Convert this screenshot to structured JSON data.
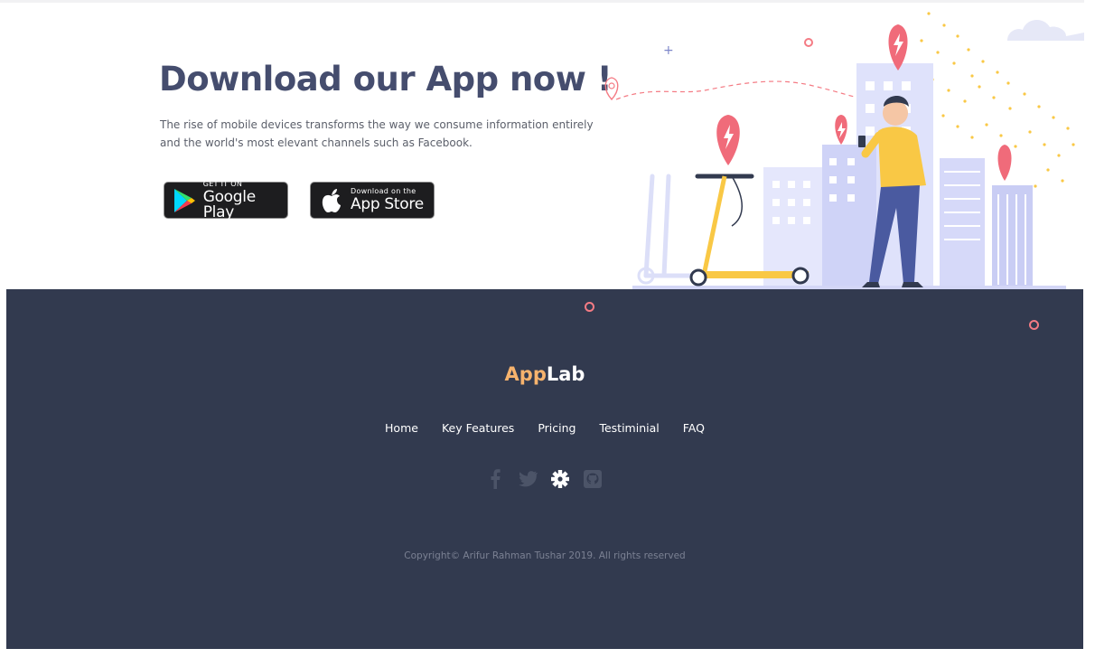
{
  "hero": {
    "title": "Download our App now !",
    "description": "The rise of mobile devices transforms the way we consume information entirely and the world's most elevant channels such as Facebook.",
    "google_play": {
      "small": "GET IT ON",
      "big": "Google Play"
    },
    "app_store": {
      "small": "Download on the",
      "big": "App Store"
    }
  },
  "footer": {
    "brand_part1": "App",
    "brand_part2": "Lab",
    "nav": [
      "Home",
      "Key Features",
      "Pricing",
      "Testiminial",
      "FAQ"
    ],
    "social_icons": [
      "facebook-icon",
      "twitter-icon",
      "gear-icon",
      "github-icon"
    ],
    "copyright": "Copyright© Arifur Rahman Tushar 2019. All rights reserved"
  },
  "colors": {
    "title": "#454d6e",
    "footer_bg": "#323a4f",
    "brand_accent": "#f7b36d",
    "accent_pink": "#f47b84",
    "illustration_yellow": "#f9c845"
  }
}
